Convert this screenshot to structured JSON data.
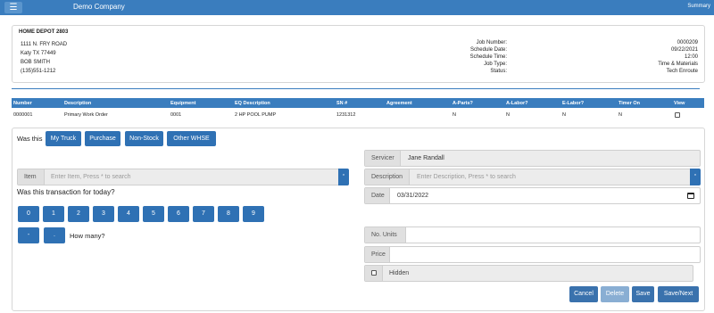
{
  "topbar": {
    "menu_icon": "hamburger-icon",
    "company": "Demo Company",
    "summary": "Summary"
  },
  "store": {
    "name": "HOME DEPOT 2803",
    "address": [
      "1111 N. FRY ROAD",
      "Katy TX 77449",
      "BOB SMITH",
      "(135)551-1212"
    ],
    "info": [
      {
        "label": "Job Number:",
        "value": "0000209"
      },
      {
        "label": "Schedule Date:",
        "value": "09/22/2021"
      },
      {
        "label": "Schedule Time:",
        "value": "12:00"
      },
      {
        "label": "Job Type:",
        "value": "Time & Materials"
      },
      {
        "label": "Status:",
        "value": "Tech Enroute"
      }
    ]
  },
  "table": {
    "headers": [
      "Number",
      "Description",
      "Equipment",
      "EQ Description",
      "SN #",
      "Agreement",
      "A-Parts?",
      "A-Labor?",
      "E-Labor?",
      "Timer On",
      "View"
    ],
    "rows": [
      [
        "0000001",
        "Primary Work Order",
        "0001",
        "2 HP POOL PUMP",
        "1231312",
        "",
        "N",
        "N",
        "N",
        "N"
      ]
    ]
  },
  "source": {
    "prompt": "Was this",
    "buttons": [
      "My Truck",
      "Purchase",
      "Non-Stock",
      "Other WHSE"
    ]
  },
  "item": {
    "label": "Item",
    "placeholder": "Enter Item, Press * to search",
    "dropdown": "*"
  },
  "today_question": "Was this transaction for today?",
  "keypad": {
    "digits": [
      "0",
      "1",
      "2",
      "3",
      "4",
      "5",
      "6",
      "7",
      "8",
      "9"
    ],
    "minus": "-",
    "dot": ".",
    "prompt": "How many?"
  },
  "servicer": {
    "label": "Servicer",
    "value": "Jane Randall"
  },
  "description": {
    "label": "Description",
    "placeholder": "Enter Description, Press * to search",
    "dropdown": "*"
  },
  "date": {
    "label": "Date",
    "value": "03/31/2022"
  },
  "units": {
    "label": "No. Units",
    "value": ""
  },
  "price": {
    "label": "Price",
    "value": ""
  },
  "hidden": {
    "label": "Hidden",
    "checked": false
  },
  "actions": {
    "cancel": "Cancel",
    "delete": "Delete",
    "save": "Save",
    "save_next": "Save/Next"
  },
  "colors": {
    "primary": "#2f71b4",
    "header": "#3a7dbe",
    "disabled": "#89aed3"
  }
}
